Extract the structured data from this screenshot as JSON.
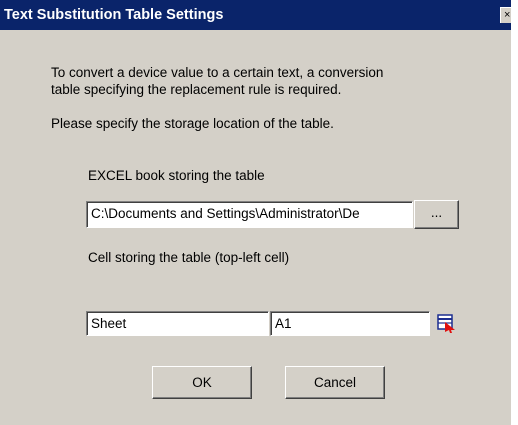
{
  "dialog": {
    "title": "Text Substitution Table Settings",
    "close_glyph": "×",
    "intro_line1": "To convert a device value to a certain text, a conversion",
    "intro_line2": "table specifying the replacement rule is required.",
    "intro_line3": "Please specify the storage location of the table.",
    "excel_label": "EXCEL book storing the table",
    "excel_path": "C:\\Documents and Settings\\Administrator\\De",
    "browse_label": "...",
    "cell_label": "Cell storing the table (top-left cell)",
    "sheet_value": "Sheet",
    "cell_value": "A1",
    "ok_label": "OK",
    "cancel_label": "Cancel"
  },
  "colors": {
    "window_bg": "#d4d0c8",
    "titlebar_bg": "#0a246a",
    "title_text": "#ffffff",
    "picker_red": "#e01010",
    "picker_blue": "#1c2d8f"
  },
  "icons": {
    "close": "close-icon",
    "cell_picker": "cell-picker-icon"
  }
}
